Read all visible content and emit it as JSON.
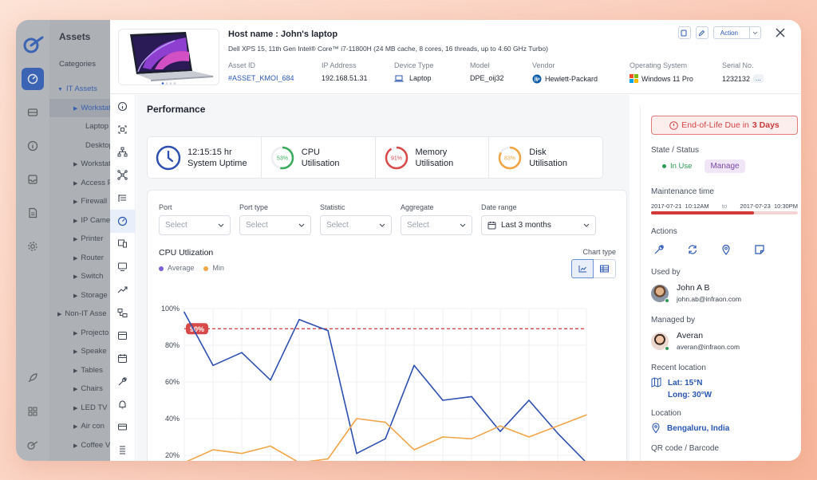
{
  "background_app": {
    "title": "Assets",
    "categories_label": "Categories",
    "tree": [
      {
        "label": "IT Assets",
        "level": 0,
        "expanded": true,
        "style": "blue"
      },
      {
        "label": "Workstat",
        "level": 1,
        "style": "hl"
      },
      {
        "label": "Laptop",
        "level": 2
      },
      {
        "label": "Desktop",
        "level": 2
      },
      {
        "label": "Workstat",
        "level": 1
      },
      {
        "label": "Access P",
        "level": 1
      },
      {
        "label": "Firewall",
        "level": 1
      },
      {
        "label": "IP Came",
        "level": 1
      },
      {
        "label": "Printer",
        "level": 1
      },
      {
        "label": "Router",
        "level": 1
      },
      {
        "label": "Switch",
        "level": 1
      },
      {
        "label": "Storage",
        "level": 1
      },
      {
        "label": "Non-IT Asse",
        "level": 0
      },
      {
        "label": "Projecto",
        "level": 1
      },
      {
        "label": "Speake",
        "level": 1
      },
      {
        "label": "Tables",
        "level": 1
      },
      {
        "label": "Chairs",
        "level": 1
      },
      {
        "label": "LED TV",
        "level": 1
      },
      {
        "label": "Air con",
        "level": 1
      },
      {
        "label": "Coffee V",
        "level": 1
      }
    ]
  },
  "header": {
    "hostname": "Host name : John's laptop",
    "model_desc": "Dell XPS 15, 11th Gen Intel® Core™ i7-11800H (24 MB cache, 8 cores, 16 threads, up to 4.60 GHz Turbo)",
    "fields": {
      "asset_id": {
        "label": "Asset ID",
        "value": "#ASSET_KMOI_684"
      },
      "ip": {
        "label": "IP Address",
        "value": "192.168.51.31"
      },
      "device_type": {
        "label": "Device Type",
        "value": "Laptop"
      },
      "model": {
        "label": "Model",
        "value": "DPE_oij32"
      },
      "vendor": {
        "label": "Vendor",
        "value": "Hewlett-Packard"
      },
      "os": {
        "label": "Operating System",
        "value": "Windows 11 Pro"
      },
      "serial": {
        "label": "Serial No.",
        "value": "1232132",
        "more": "..."
      }
    },
    "action_label": "Action"
  },
  "performance": {
    "title": "Performance",
    "stats": [
      {
        "value": "12:15:15 hr",
        "label": "System Uptime"
      },
      {
        "title": "CPU",
        "label": "Utilisation",
        "pct_text": "53%",
        "pct": 0.53,
        "color": "#3aaa5c"
      },
      {
        "title": "Memory",
        "label": "Utilisation",
        "pct_text": "91%",
        "pct": 0.91,
        "color": "#d84a4a"
      },
      {
        "title": "Disk",
        "label": "Utilisation",
        "pct_text": "83%",
        "pct": 0.83,
        "color": "#f0a542"
      }
    ],
    "filters": [
      {
        "label": "Port",
        "placeholder": "Select"
      },
      {
        "label": "Port type",
        "placeholder": "Select"
      },
      {
        "label": "Statistic",
        "placeholder": "Select"
      },
      {
        "label": "Aggregate",
        "placeholder": "Select"
      }
    ],
    "date_range": {
      "label": "Date range",
      "value": "Last 3 months"
    },
    "chart_type_label": "Chart type"
  },
  "chart_data": {
    "type": "line",
    "title": "CPU Utlization",
    "y_ticks": [
      "100%",
      "80%",
      "60%",
      "40%",
      "20%"
    ],
    "ylim": [
      15,
      100
    ],
    "threshold": {
      "value": 89,
      "label": "90%"
    },
    "series": [
      {
        "name": "Average",
        "color": "#2d4fb0",
        "values": [
          98,
          69,
          76,
          61,
          94,
          88,
          21,
          29,
          69,
          50,
          52,
          33,
          50,
          32,
          16
        ]
      },
      {
        "name": "Min",
        "color": "#f2a64a",
        "values": [
          16,
          23,
          21,
          25,
          16,
          18,
          40,
          38,
          23,
          30,
          29,
          36,
          30,
          36,
          42
        ]
      }
    ],
    "legend_dot_colors": [
      "#7c5fd3",
      "#f2a64a"
    ]
  },
  "details": {
    "eol_prefix": "End-of-Life Due in",
    "eol_days": "3 Days",
    "state_label": "State / Status",
    "state_value": "In Use",
    "manage_label": "Manage",
    "maintenance_label": "Maintenance time",
    "maint_start_date": "2017-07-21",
    "maint_start_time": "10:12AM",
    "maint_to": "to",
    "maint_end_date": "2017-07-23",
    "maint_end_time": "10:30PM",
    "maint_progress": 0.7,
    "actions_label": "Actions",
    "used_by_label": "Used by",
    "used_by_name": "John A B",
    "used_by_email": "john.ab@infraon.com",
    "managed_by_label": "Managed by",
    "managed_by_name": "Averan",
    "managed_by_email": "averan@infraon.com",
    "recent_location_label": "Recent location",
    "lat": "Lat: 15°N",
    "long": "Long: 30°W",
    "location_label": "Location",
    "location_value": "Bengaluru, India",
    "qr_label": "QR code / Barcode"
  }
}
